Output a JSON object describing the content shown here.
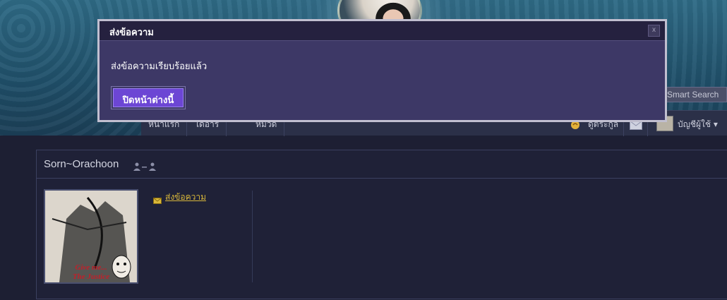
{
  "dialog": {
    "title": "ส่งข้อความ",
    "close_label": "x",
    "message": "ส่งข้อความเรียบร้อยแล้ว",
    "button_label": "ปิดหน้าต่างนี้"
  },
  "header": {
    "smart_search": "Smart Search",
    "nav_tabs": [
      "หน้าแรก",
      "ไดอารี่",
      "หมวด"
    ],
    "right": {
      "guide_label": "ดูตระกูล",
      "account_label": "บัญชีผู้ใช้ ▾"
    }
  },
  "profile": {
    "username": "Sorn~Orachoon",
    "send_message_link": "ส่งข้อความ",
    "avatar_caption_1": "Give me...",
    "avatar_caption_2": "The Justice"
  },
  "colors": {
    "dialog_bg": "#3d3866",
    "dialog_title_bg": "#25213f",
    "button_bg": "#6c46d4",
    "link_color": "#d9b83a",
    "page_bg": "#1d1f33"
  }
}
